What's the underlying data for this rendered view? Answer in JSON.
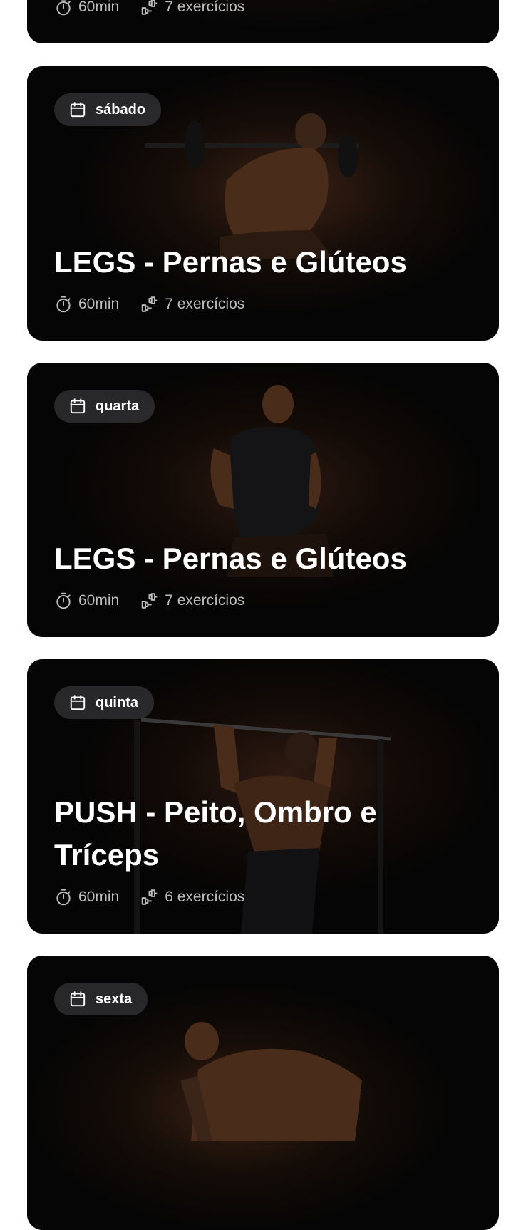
{
  "workouts": [
    {
      "day": "",
      "title": "",
      "duration": "60min",
      "exercises": "7 exercícios"
    },
    {
      "day": "sábado",
      "title": "LEGS - Pernas e Glúteos",
      "duration": "60min",
      "exercises": "7 exercícios"
    },
    {
      "day": "quarta",
      "title": "LEGS - Pernas e Glúteos",
      "duration": "60min",
      "exercises": "7 exercícios"
    },
    {
      "day": "quinta",
      "title": "PUSH - Peito, Ombro e Tríceps",
      "duration": "60min",
      "exercises": "6 exercícios"
    },
    {
      "day": "sexta",
      "title": "",
      "duration": "",
      "exercises": ""
    }
  ],
  "icons": {
    "calendar": "calendar-icon",
    "timer": "stopwatch-icon",
    "exercises": "dumbbell-icon"
  },
  "colors": {
    "card_background": "#050505",
    "badge_background": "#46464a",
    "title_text": "#ffffff",
    "meta_text": "#bdbdbd",
    "page_background": "#ffffff"
  }
}
